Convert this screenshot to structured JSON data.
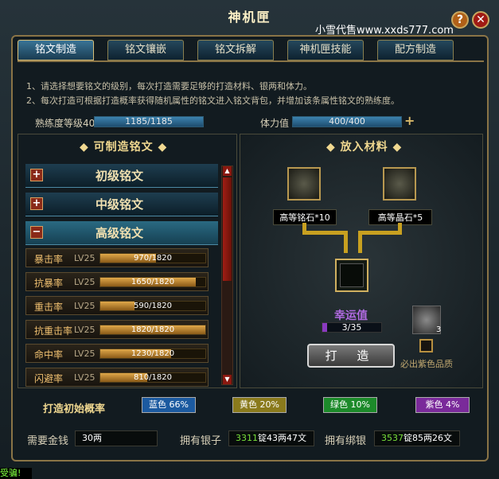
{
  "window": {
    "title": "神机匣",
    "watermark": "小雪代售www.xxds777.com",
    "help_label": "?",
    "close_label": "✕"
  },
  "tabs": [
    {
      "label": "铭文制造",
      "active": true
    },
    {
      "label": "铭文镶嵌",
      "active": false
    },
    {
      "label": "铭文拆解",
      "active": false
    },
    {
      "label": "神机匣技能",
      "active": false
    },
    {
      "label": "配方制造",
      "active": false
    }
  ],
  "notes": [
    "1、请选择想要铭文的级别，每次打造需要足够的打造材料、银两和体力。",
    "2、每次打造可根据打造概率获得随机属性的铭文进入铭文背包，并增加该条属性铭文的熟练度。"
  ],
  "stats": {
    "proficiency_label": "熟练度等级40",
    "proficiency_value": "1185/1185",
    "proficiency_fraction": 1.0,
    "stamina_label": "体力值",
    "stamina_value": "400/400",
    "stamina_fraction": 1.0,
    "plus_label": "+"
  },
  "left_panel": {
    "heading": "◆ 可制造铭文 ◆",
    "categories": [
      {
        "label": "初级铭文",
        "toggle": "+"
      },
      {
        "label": "中级铭文",
        "toggle": "+"
      },
      {
        "label": "高级铭文",
        "toggle": "−"
      }
    ],
    "items": [
      {
        "name": "暴击率",
        "level": "LV25",
        "progress": "970/1820",
        "fraction": 0.533
      },
      {
        "name": "抗暴率",
        "level": "LV25",
        "progress": "1650/1820",
        "fraction": 0.907
      },
      {
        "name": "重击率",
        "level": "LV25",
        "progress": "590/1820",
        "fraction": 0.324
      },
      {
        "name": "抗重击率",
        "level": "LV25",
        "progress": "1820/1820",
        "fraction": 1.0
      },
      {
        "name": "命中率",
        "level": "LV25",
        "progress": "1230/1820",
        "fraction": 0.676
      },
      {
        "name": "闪避率",
        "level": "LV25",
        "progress": "810/1820",
        "fraction": 0.445
      }
    ]
  },
  "right_panel": {
    "heading": "◆ 放入材料 ◆",
    "material_left": "高等铭石*10",
    "material_right": "高等晶石*5",
    "luck_label": "幸运值",
    "luck_value": "3/35",
    "luck_fraction": 0.0857,
    "forge_label": "打 造",
    "crystal_count": "3",
    "purple_label": "必出紫色品质"
  },
  "probability": {
    "label": "打造初始概率",
    "items": [
      {
        "label": "蓝色 66%",
        "color": "#1c5aa0"
      },
      {
        "label": "黄色 20%",
        "color": "#8a7a1c"
      },
      {
        "label": "绿色 10%",
        "color": "#1c8a2a"
      },
      {
        "label": "紫色 4%",
        "color": "#7a2a9a"
      }
    ]
  },
  "bottom": {
    "money_label": "需要金钱",
    "money_value": "30两",
    "silver_label": "拥有银子",
    "silver_green": "3311",
    "silver_rest": "锭43两47文",
    "bound_label": "拥有绑银",
    "bound_green": "3537",
    "bound_rest": "锭85两26文"
  },
  "chat_snippet": "受骗!"
}
